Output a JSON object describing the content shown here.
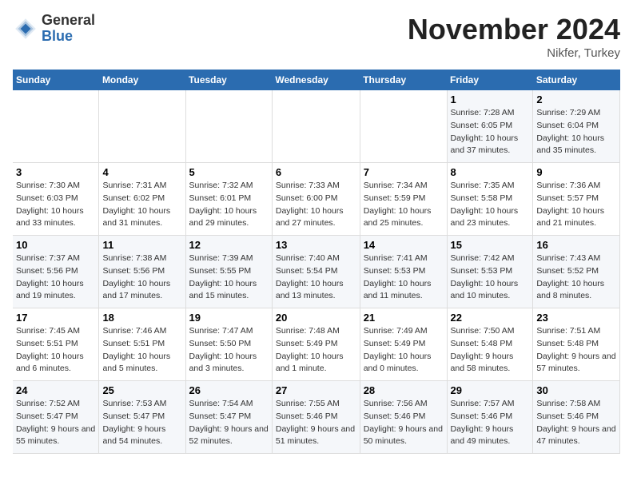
{
  "header": {
    "logo_line1": "General",
    "logo_line2": "Blue",
    "month": "November 2024",
    "location": "Nikfer, Turkey"
  },
  "weekdays": [
    "Sunday",
    "Monday",
    "Tuesday",
    "Wednesday",
    "Thursday",
    "Friday",
    "Saturday"
  ],
  "weeks": [
    [
      {
        "day": "",
        "info": ""
      },
      {
        "day": "",
        "info": ""
      },
      {
        "day": "",
        "info": ""
      },
      {
        "day": "",
        "info": ""
      },
      {
        "day": "",
        "info": ""
      },
      {
        "day": "1",
        "info": "Sunrise: 7:28 AM\nSunset: 6:05 PM\nDaylight: 10 hours and 37 minutes."
      },
      {
        "day": "2",
        "info": "Sunrise: 7:29 AM\nSunset: 6:04 PM\nDaylight: 10 hours and 35 minutes."
      }
    ],
    [
      {
        "day": "3",
        "info": "Sunrise: 7:30 AM\nSunset: 6:03 PM\nDaylight: 10 hours and 33 minutes."
      },
      {
        "day": "4",
        "info": "Sunrise: 7:31 AM\nSunset: 6:02 PM\nDaylight: 10 hours and 31 minutes."
      },
      {
        "day": "5",
        "info": "Sunrise: 7:32 AM\nSunset: 6:01 PM\nDaylight: 10 hours and 29 minutes."
      },
      {
        "day": "6",
        "info": "Sunrise: 7:33 AM\nSunset: 6:00 PM\nDaylight: 10 hours and 27 minutes."
      },
      {
        "day": "7",
        "info": "Sunrise: 7:34 AM\nSunset: 5:59 PM\nDaylight: 10 hours and 25 minutes."
      },
      {
        "day": "8",
        "info": "Sunrise: 7:35 AM\nSunset: 5:58 PM\nDaylight: 10 hours and 23 minutes."
      },
      {
        "day": "9",
        "info": "Sunrise: 7:36 AM\nSunset: 5:57 PM\nDaylight: 10 hours and 21 minutes."
      }
    ],
    [
      {
        "day": "10",
        "info": "Sunrise: 7:37 AM\nSunset: 5:56 PM\nDaylight: 10 hours and 19 minutes."
      },
      {
        "day": "11",
        "info": "Sunrise: 7:38 AM\nSunset: 5:56 PM\nDaylight: 10 hours and 17 minutes."
      },
      {
        "day": "12",
        "info": "Sunrise: 7:39 AM\nSunset: 5:55 PM\nDaylight: 10 hours and 15 minutes."
      },
      {
        "day": "13",
        "info": "Sunrise: 7:40 AM\nSunset: 5:54 PM\nDaylight: 10 hours and 13 minutes."
      },
      {
        "day": "14",
        "info": "Sunrise: 7:41 AM\nSunset: 5:53 PM\nDaylight: 10 hours and 11 minutes."
      },
      {
        "day": "15",
        "info": "Sunrise: 7:42 AM\nSunset: 5:53 PM\nDaylight: 10 hours and 10 minutes."
      },
      {
        "day": "16",
        "info": "Sunrise: 7:43 AM\nSunset: 5:52 PM\nDaylight: 10 hours and 8 minutes."
      }
    ],
    [
      {
        "day": "17",
        "info": "Sunrise: 7:45 AM\nSunset: 5:51 PM\nDaylight: 10 hours and 6 minutes."
      },
      {
        "day": "18",
        "info": "Sunrise: 7:46 AM\nSunset: 5:51 PM\nDaylight: 10 hours and 5 minutes."
      },
      {
        "day": "19",
        "info": "Sunrise: 7:47 AM\nSunset: 5:50 PM\nDaylight: 10 hours and 3 minutes."
      },
      {
        "day": "20",
        "info": "Sunrise: 7:48 AM\nSunset: 5:49 PM\nDaylight: 10 hours and 1 minute."
      },
      {
        "day": "21",
        "info": "Sunrise: 7:49 AM\nSunset: 5:49 PM\nDaylight: 10 hours and 0 minutes."
      },
      {
        "day": "22",
        "info": "Sunrise: 7:50 AM\nSunset: 5:48 PM\nDaylight: 9 hours and 58 minutes."
      },
      {
        "day": "23",
        "info": "Sunrise: 7:51 AM\nSunset: 5:48 PM\nDaylight: 9 hours and 57 minutes."
      }
    ],
    [
      {
        "day": "24",
        "info": "Sunrise: 7:52 AM\nSunset: 5:47 PM\nDaylight: 9 hours and 55 minutes."
      },
      {
        "day": "25",
        "info": "Sunrise: 7:53 AM\nSunset: 5:47 PM\nDaylight: 9 hours and 54 minutes."
      },
      {
        "day": "26",
        "info": "Sunrise: 7:54 AM\nSunset: 5:47 PM\nDaylight: 9 hours and 52 minutes."
      },
      {
        "day": "27",
        "info": "Sunrise: 7:55 AM\nSunset: 5:46 PM\nDaylight: 9 hours and 51 minutes."
      },
      {
        "day": "28",
        "info": "Sunrise: 7:56 AM\nSunset: 5:46 PM\nDaylight: 9 hours and 50 minutes."
      },
      {
        "day": "29",
        "info": "Sunrise: 7:57 AM\nSunset: 5:46 PM\nDaylight: 9 hours and 49 minutes."
      },
      {
        "day": "30",
        "info": "Sunrise: 7:58 AM\nSunset: 5:46 PM\nDaylight: 9 hours and 47 minutes."
      }
    ]
  ]
}
